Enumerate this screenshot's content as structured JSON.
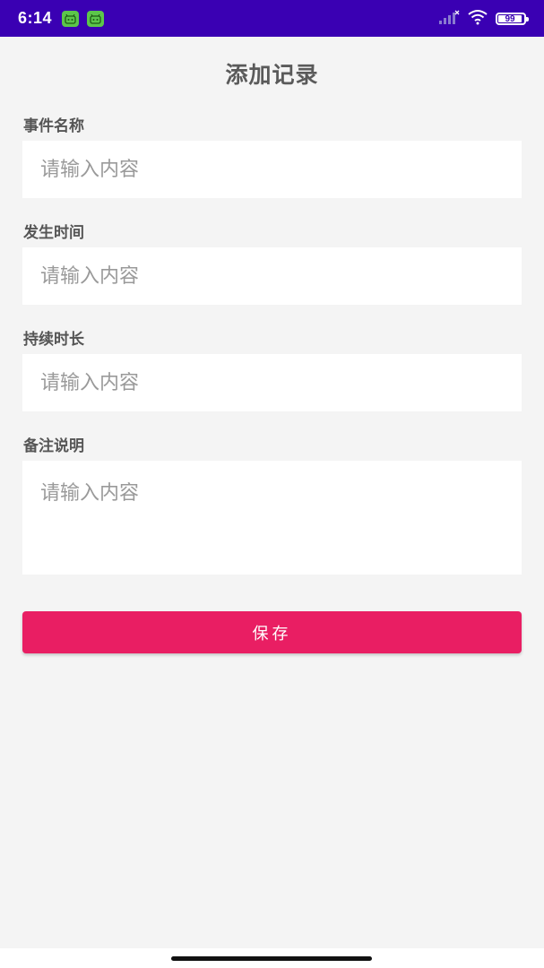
{
  "status_bar": {
    "time": "6:14",
    "battery_level": "99",
    "icons": [
      "app-notification-icon",
      "app-notification-icon",
      "signal-icon",
      "wifi-icon",
      "battery-icon"
    ],
    "background_color": "#3a00b3"
  },
  "page": {
    "title": "添加记录"
  },
  "form": {
    "fields": [
      {
        "label": "事件名称",
        "placeholder": "请输入内容",
        "value": ""
      },
      {
        "label": "发生时间",
        "placeholder": "请输入内容",
        "value": ""
      },
      {
        "label": "持续时长",
        "placeholder": "请输入内容",
        "value": ""
      },
      {
        "label": "备注说明",
        "placeholder": "请输入内容",
        "value": ""
      }
    ],
    "save_label": "保存",
    "accent_color": "#e91e63"
  }
}
